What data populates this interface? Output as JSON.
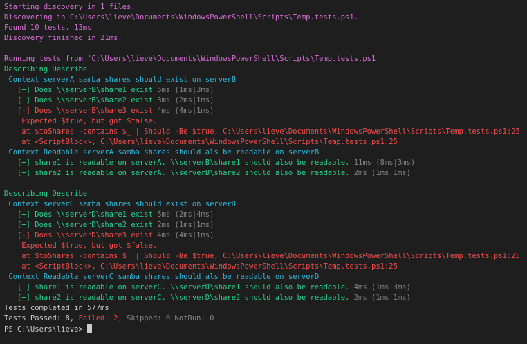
{
  "discovery": {
    "start": "Starting discovery in 1 files.",
    "discovering": "Discovering in C:\\Users\\lieve\\Documents\\WindowsPowerShell\\Scripts\\Temp.tests.ps1.",
    "found": "Found 10 tests. 13ms",
    "finished": "Discovery finished in 21ms."
  },
  "running": "Running tests from 'C:\\Users\\lieve\\Documents\\WindowsPowerShell\\Scripts\\Temp.tests.ps1'",
  "block1": {
    "describe": "Describing Describe",
    "context1": " Context serverA samba shares should exist on serverB",
    "t1": "   [+] Does \\\\serverB\\share1 exist",
    "t1_time": " 5ms (1ms|3ms)",
    "t2": "   [+] Does \\\\serverB\\share2 exist",
    "t2_time": " 3ms (2ms|1ms)",
    "t3": "   [-] Does \\\\serverB\\share3 exist",
    "t3_time": " 4ms (4ms|1ms)",
    "err1": "    Expected $true, but got $false.",
    "err2": "    at $toShares -contains $_ | Should -Be $true, C:\\Users\\lieve\\Documents\\WindowsPowerShell\\Scripts\\Temp.tests.ps1:25",
    "err3": "    at <ScriptBlock>, C:\\Users\\lieve\\Documents\\WindowsPowerShell\\Scripts\\Temp.tests.ps1:25",
    "context2": " Context Readable serverA samba shares should als be readable on serverB",
    "r1": "   [+] share1 is readable on serverA. \\\\serverB\\share1 should also be readable.",
    "r1_time": " 11ms (8ms|3ms)",
    "r2": "   [+] share2 is readable on serverA. \\\\serverB\\share2 should also be readable.",
    "r2_time": " 2ms (1ms|1ms)"
  },
  "block2": {
    "describe": "Describing Describe",
    "context1": " Context serverC samba shares should exist on serverD",
    "t1": "   [+] Does \\\\serverD\\share1 exist",
    "t1_time": " 5ms (2ms|4ms)",
    "t2": "   [+] Does \\\\serverD\\share2 exist",
    "t2_time": " 2ms (1ms|1ms)",
    "t3": "   [-] Does \\\\serverD\\share3 exist",
    "t3_time": " 4ms (4ms|1ms)",
    "err1": "    Expected $true, but got $false.",
    "err2": "    at $toShares -contains $_ | Should -Be $true, C:\\Users\\lieve\\Documents\\WindowsPowerShell\\Scripts\\Temp.tests.ps1:25",
    "err3": "    at <ScriptBlock>, C:\\Users\\lieve\\Documents\\WindowsPowerShell\\Scripts\\Temp.tests.ps1:25",
    "context2": " Context Readable serverC samba shares should als be readable on serverD",
    "r1": "   [+] share1 is readable on serverC. \\\\serverD\\share1 should also be readable.",
    "r1_time": " 4ms (1ms|3ms)",
    "r2": "   [+] share2 is readable on serverC. \\\\serverD\\share2 should also be readable.",
    "r2_time": " 2ms (1ms|1ms)"
  },
  "summary": {
    "completed": "Tests completed in 577ms",
    "passed": "Tests Passed: 8, ",
    "failed": "Failed: 2, ",
    "skipped": "Skipped: 0 NotRun: 0"
  },
  "prompt": "PS C:\\Users\\lieve> "
}
